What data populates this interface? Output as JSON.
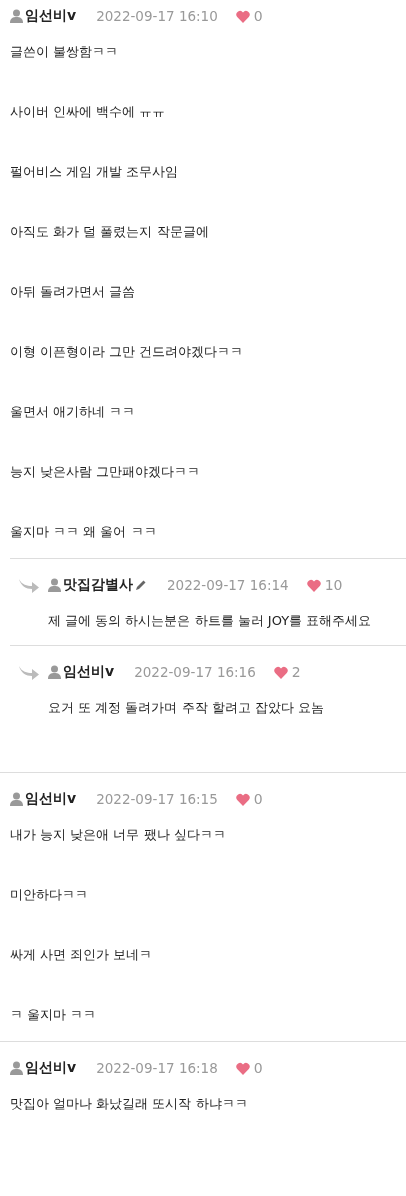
{
  "comments": [
    {
      "author": "임선비v",
      "pencil": false,
      "date": "2022-09-17 16:10",
      "likes": "0",
      "lines": [
        "글쓴이 불쌍함ㅋㅋ",
        "사이버 인싸에 백수에 ㅠㅠ",
        "펄어비스 게임 개발 조무사임",
        "아직도 화가 덜 풀렸는지 작문글에",
        "아뒤 돌려가면서 글씀",
        "이형 이픈형이라 그만 건드려야겠다ㅋㅋ",
        "울면서 애기하네 ㅋㅋ",
        "능지 낮은사람 그만패야겠다ㅋㅋ",
        "울지마 ㅋㅋ 왜 울어 ㅋㅋ"
      ],
      "replies": [
        {
          "author": "맛집감별사",
          "pencil": true,
          "date": "2022-09-17 16:14",
          "likes": "10",
          "lines": [
            "제 글에 동의 하시는분은 하트를 눌러 JOY를 표해주세요"
          ]
        },
        {
          "author": "임선비v",
          "pencil": false,
          "date": "2022-09-17 16:16",
          "likes": "2",
          "lines": [
            "요거 또 계정 돌려가며 주작 할려고 잡았다 요놈"
          ]
        }
      ]
    },
    {
      "author": "임선비v",
      "pencil": false,
      "date": "2022-09-17 16:15",
      "likes": "0",
      "lines": [
        "내가 능지 낮은애 너무 팼나 싶다ㅋㅋ",
        "미안하다ㅋㅋ",
        "싸게 사면 죄인가 보네ㅋ",
        "ㅋ 울지마 ㅋㅋ"
      ]
    },
    {
      "author": "임선비v",
      "pencil": false,
      "date": "2022-09-17 16:18",
      "likes": "0",
      "lines": [
        "맛집아 얼마나 화났길래 또시작 하냐ㅋㅋ"
      ]
    }
  ]
}
